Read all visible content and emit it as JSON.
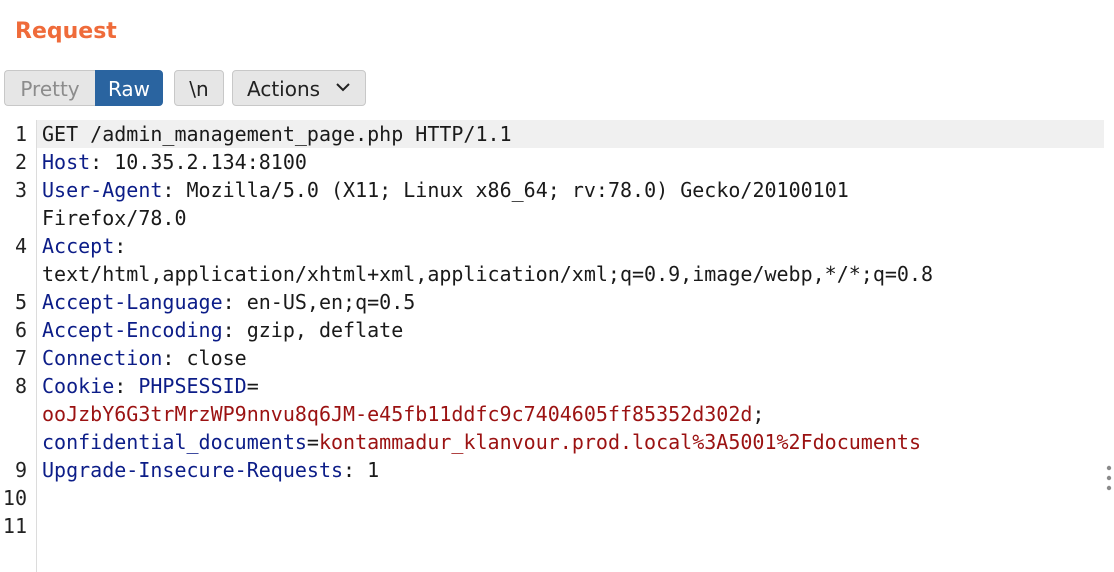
{
  "panel": {
    "title": "Request"
  },
  "toolbar": {
    "pretty_label": "Pretty",
    "raw_label": "Raw",
    "newline_label": "\\n",
    "actions_label": "Actions",
    "selected": "Raw"
  },
  "editor": {
    "line_numbers": [
      "1",
      "2",
      "3",
      "4",
      "5",
      "6",
      "7",
      "8",
      "9",
      "10",
      "11"
    ],
    "request_line": "GET /admin_management_page.php HTTP/1.1",
    "headers": {
      "host": {
        "name": "Host",
        "value": "10.35.2.134:8100"
      },
      "user_agent": {
        "name": "User-Agent",
        "value": "Mozilla/5.0 (X11; Linux x86_64; rv:78.0) Gecko/20100101",
        "value_cont": "Firefox/78.0"
      },
      "accept": {
        "name": "Accept",
        "value": "text/html,application/xhtml+xml,application/xml;q=0.9,image/webp,*/*;q=0.8"
      },
      "accept_language": {
        "name": "Accept-Language",
        "value": "en-US,en;q=0.5"
      },
      "accept_encoding": {
        "name": "Accept-Encoding",
        "value": "gzip, deflate"
      },
      "connection": {
        "name": "Connection",
        "value": "close"
      },
      "cookie": {
        "name": "Cookie",
        "cookie1_name": "PHPSESSID",
        "cookie1_value": "ooJzbY6G3trMrzWP9nnvu8q6JM-e45fb11ddfc9c7404605ff85352d302d",
        "cookie2_name": "confidential_documents",
        "cookie2_value": "kontammadur_klanvour.prod.local%3A5001%2Fdocuments"
      },
      "upgrade": {
        "name": "Upgrade-Insecure-Requests",
        "value": "1"
      }
    }
  },
  "colors": {
    "title": "#ef6b3a",
    "raw_selected_bg": "#2a64a0",
    "header_name": "#0c1d88",
    "cookie_value": "#9b1212"
  },
  "icons": {
    "actions_chevron": "chevron-down-icon",
    "scroll_handle": "more-vertical-icon"
  }
}
